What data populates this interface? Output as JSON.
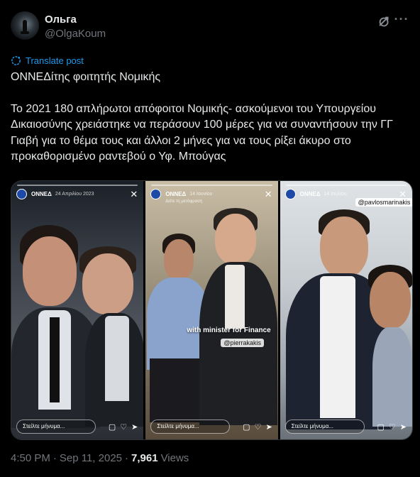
{
  "author": {
    "name": "Ольга",
    "handle": "@OlgaKoum"
  },
  "translate_label": "Translate post",
  "post": {
    "line1": "ΟΝΝΕΔίτης φοιτητής Νομικής",
    "line2": "Το 2021 180 απλήρωτοι απόφοιτοι Νομικής- ασκούμενοι του Υπουργείου Δικαιοσύνης χρειάστηκε να περάσουν 100 μέρες για να συναντήσουν την ΓΓ Γιαβή για το θέμα τους και άλλοι 2 μήνες για να τους ρίξει άκυρο στο προκαθορισμένο ραντεβού ο Υφ. Μπούγας"
  },
  "media": {
    "panels": [
      {
        "account": "ΟΝΝΕΔ",
        "date": "24 Απριλίου 2023",
        "reply_placeholder": "Στείλτε μήνυμα...",
        "caption": "",
        "tag": "",
        "subline": ""
      },
      {
        "account": "ΟΝΝΕΔ",
        "date": "14 Ιουνίου",
        "reply_placeholder": "Στείλτε μήνυμα...",
        "caption": "with minister for Finance",
        "tag": "@pierrakakis",
        "subline": "Δείτε τη μετάφραση"
      },
      {
        "account": "ΟΝΝΕΔ",
        "date": "14 Ιουλίου",
        "reply_placeholder": "Στείλτε μήνυμα...",
        "caption": "",
        "tag": "@pavlosmarinakis",
        "subline": ""
      }
    ]
  },
  "meta": {
    "time": "4:50 PM",
    "separator": "·",
    "date": "Sep 11, 2025",
    "views_count": "7,961",
    "views_label": "Views"
  },
  "colors": {
    "background": "#000000",
    "text": "#e7e9ea",
    "muted": "#71767b",
    "link": "#1d9bf0"
  }
}
